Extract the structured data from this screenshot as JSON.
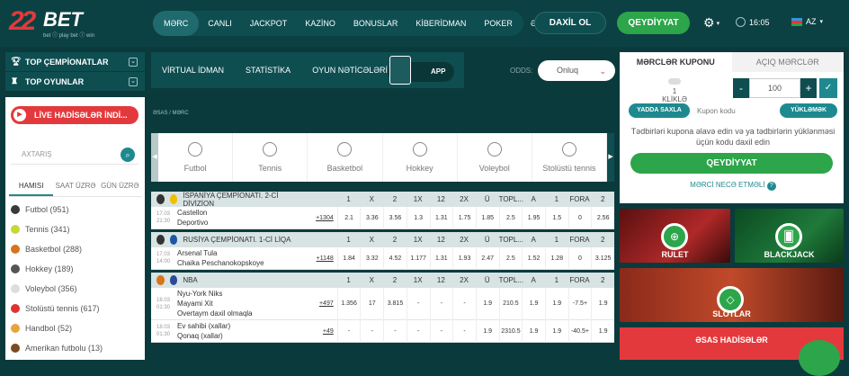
{
  "brand": {
    "name_num": "22",
    "name_bet": "BET",
    "tagline": "bet ⓘ play  bet ⓘ win"
  },
  "nav": [
    "MƏRC",
    "CANLI",
    "JACKPOT",
    "KAZİNO",
    "BONUSLAR",
    "KİBERİDMAN",
    "POKER",
    "ƏLAVƏ"
  ],
  "header": {
    "login": "DAXİL OL",
    "register": "QEYDİYYAT",
    "time": "16:05",
    "lang": "AZ"
  },
  "sidebar": {
    "top_champ": "TOP ÇEMPİONATLAR",
    "top_games": "TOP OYUNLAR",
    "live_btn": "LİVE HADİSƏLƏR İNDİ...",
    "search_placeholder": "AXTARIŞ",
    "filter_tabs": [
      "HAMISI",
      "SAAT ÜZRƏ",
      "GÜN ÜZRƏ"
    ],
    "sports": [
      {
        "label": "Futbol (951)",
        "color": "#3a3a3a"
      },
      {
        "label": "Tennis (341)",
        "color": "#c7d63a"
      },
      {
        "label": "Basketbol (288)",
        "color": "#d9731e"
      },
      {
        "label": "Hokkey (189)",
        "color": "#555555"
      },
      {
        "label": "Voleybol (356)",
        "color": "#dddddd"
      },
      {
        "label": "Stolüstü tennis (617)",
        "color": "#d33"
      },
      {
        "label": "Handbol (52)",
        "color": "#e7a33c"
      },
      {
        "label": "Amerikan futbolu (13)",
        "color": "#7a4a20"
      }
    ]
  },
  "center": {
    "tabs": [
      "VİRTUAL İDMAN",
      "STATİSTİKA",
      "OYUN NƏTİCƏLƏRİ"
    ],
    "app_label": "APP",
    "odds_label": "ODDS:",
    "odds_value": "Onluq",
    "breadcrumb": "ƏSAS  /  MƏRC",
    "sport_icons": [
      "Futbol",
      "Tennis",
      "Basketbol",
      "Hokkey",
      "Voleybol",
      "Stolüstü tennis"
    ]
  },
  "colors": {
    "accent": "#2da54a",
    "brand_red": "#e4393c",
    "teal": "#1e8a8f",
    "dark": "#0b3a3c"
  },
  "events": [
    {
      "league": "İSPANİYA ÇEMPİONATI. 2-Cİ DİVİZİON",
      "ball": "#333333",
      "flag": "#f1bf00",
      "headers": [
        "1",
        "X",
        "2",
        "1X",
        "12",
        "2X",
        "Ü",
        "TOPL...",
        "A",
        "1",
        "FORA",
        "2"
      ],
      "rows": [
        {
          "time": "17.03 21:30",
          "teams": [
            "Castellon",
            "Deportivo"
          ],
          "more": "+1304",
          "odds": [
            "2.1",
            "3.36",
            "3.56",
            "1.3",
            "1.31",
            "1.75",
            "1.85",
            "2.5",
            "1.95",
            "1.5",
            "0",
            "2.56"
          ]
        }
      ]
    },
    {
      "league": "RUSİYA ÇEMPİONATI. 1-Cİ LİQA",
      "ball": "#333333",
      "flag": "#1c57a5",
      "headers": [
        "1",
        "X",
        "2",
        "1X",
        "12",
        "2X",
        "Ü",
        "TOPL...",
        "A",
        "1",
        "FORA",
        "2"
      ],
      "rows": [
        {
          "time": "17.03 14:00",
          "teams": [
            "Arsenal Tula",
            "Chaika Peschanokopskoye"
          ],
          "more": "+1148",
          "odds": [
            "1.84",
            "3.32",
            "4.52",
            "1.177",
            "1.31",
            "1.93",
            "2.47",
            "2.5",
            "1.52",
            "1.28",
            "0",
            "3.125"
          ]
        }
      ]
    },
    {
      "league": "NBA",
      "ball": "#d9731e",
      "flag": "#2b4a9a",
      "headers": [
        "1",
        "X",
        "2",
        "1X",
        "12",
        "2X",
        "Ü",
        "TOPL...",
        "A",
        "1",
        "FORA",
        "2"
      ],
      "rows": [
        {
          "time": "18.03 01:30",
          "teams": [
            "Nyu-York Niks",
            "Mayami Xit",
            "Overtaym daxil olmaqla"
          ],
          "more": "+497",
          "odds": [
            "1.356",
            "17",
            "3.815",
            "-",
            "-",
            "-",
            "1.9",
            "210.5",
            "1.9",
            "1.9",
            "-7.5+",
            "1.9"
          ]
        },
        {
          "time": "18.03 01:30",
          "teams": [
            "Ev sahibi (xallar)",
            "Qonaq (xallar)"
          ],
          "more": "+49",
          "odds": [
            "-",
            "-",
            "-",
            "-",
            "-",
            "-",
            "1.9",
            "2310.5",
            "1.9",
            "1.9",
            "-40.5+",
            "1.9"
          ]
        }
      ]
    }
  ],
  "coupon": {
    "tabs": [
      "MƏRCLƏR KUPONU",
      "AÇIQ MƏRCLƏR"
    ],
    "click_label": "1 KLİKLƏ",
    "stake": "100",
    "save": "YADDA SAXLA",
    "code": "Kupon kodu",
    "load": "YÜKLƏMƏK",
    "text": "Tədbirləri kupona əlavə edin və ya tədbirlərin yüklənməsi üçün kodu daxil edin",
    "register": "QEYDİYYAT",
    "how": "MƏRCİ NECƏ ETMƏLİ"
  },
  "casino": {
    "roulette": "RULET",
    "blackjack": "BLACKJACK",
    "slots": "SLOTLAR"
  },
  "main_events": "ƏSAS HADİSƏLƏR"
}
